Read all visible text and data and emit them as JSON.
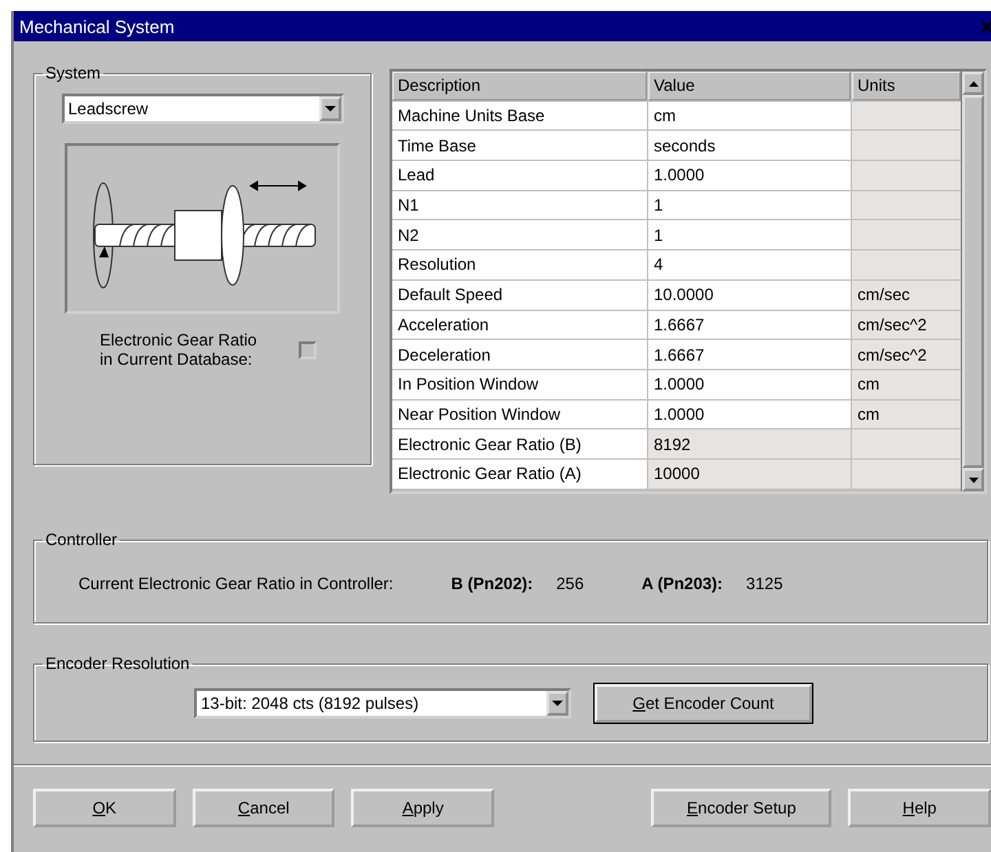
{
  "window": {
    "title": "Mechanical System"
  },
  "system": {
    "title": "System",
    "selector": {
      "value": "Leadscrew"
    },
    "gear_ratio_in_database": {
      "label": "Electronic Gear Ratio in Current Database:",
      "checked": false
    }
  },
  "table": {
    "columns": [
      "Description",
      "Value",
      "Units"
    ],
    "rows": [
      {
        "description": "Machine Units Base",
        "value": "cm",
        "units": "",
        "editable": true
      },
      {
        "description": "Time Base",
        "value": "seconds",
        "units": "",
        "editable": true
      },
      {
        "description": "Lead",
        "value": "1.0000",
        "units": "",
        "editable": true
      },
      {
        "description": "N1",
        "value": "1",
        "units": "",
        "editable": true
      },
      {
        "description": "N2",
        "value": "1",
        "units": "",
        "editable": true
      },
      {
        "description": "Resolution",
        "value": "4",
        "units": "",
        "editable": true
      },
      {
        "description": "Default Speed",
        "value": "10.0000",
        "units": "cm/sec",
        "editable": true
      },
      {
        "description": "Acceleration",
        "value": "1.6667",
        "units": "cm/sec^2",
        "editable": true
      },
      {
        "description": "Deceleration",
        "value": "1.6667",
        "units": "cm/sec^2",
        "editable": true
      },
      {
        "description": "In Position Window",
        "value": "1.0000",
        "units": "cm",
        "editable": true
      },
      {
        "description": "Near Position Window",
        "value": "1.0000",
        "units": "cm",
        "editable": true
      },
      {
        "description": "Electronic Gear Ratio (B)",
        "value": "8192",
        "units": "",
        "editable": false
      },
      {
        "description": "Electronic Gear Ratio (A)",
        "value": "10000",
        "units": "",
        "editable": false
      }
    ]
  },
  "controller": {
    "title": "Controller",
    "label": "Current Electronic Gear Ratio in Controller:",
    "b_label": "B (Pn202):",
    "b_value": "256",
    "a_label": "A (Pn203):",
    "a_value": "3125"
  },
  "encoder": {
    "title": "Encoder Resolution",
    "selector": {
      "value": "13-bit: 2048 cts (8192 pulses)"
    },
    "button": "Get Encoder Count"
  },
  "buttons": [
    "OK",
    "Cancel",
    "Apply",
    "Encoder Setup",
    "Help"
  ]
}
